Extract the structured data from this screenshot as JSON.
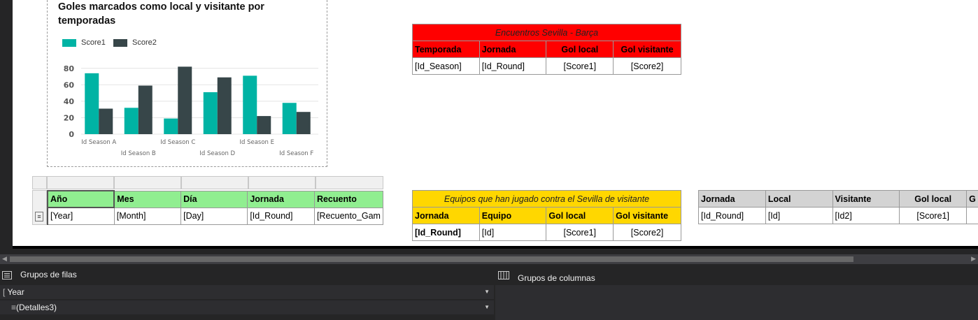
{
  "chart": {
    "title": "Goles marcados como local y visitante por temporadas",
    "legend": [
      "Score1",
      "Score2"
    ]
  },
  "chart_data": {
    "type": "bar",
    "title": "Goles marcados como local y visitante por temporadas",
    "categories": [
      "Id Season A",
      "Id Season B",
      "Id Season C",
      "Id Season D",
      "Id Season E",
      "Id Season F"
    ],
    "series": [
      {
        "name": "Score1",
        "values": [
          74,
          32,
          19,
          51,
          71,
          38
        ],
        "color": "#00b3a4"
      },
      {
        "name": "Score2",
        "values": [
          31,
          59,
          82,
          69,
          22,
          27
        ],
        "color": "#374649"
      }
    ],
    "yticks": [
      "0",
      "20",
      "40",
      "60",
      "80"
    ],
    "ylim": [
      0,
      90
    ],
    "grid": true,
    "legend_position": "top-left"
  },
  "sevilla_barca": {
    "title": "Encuentros Sevilla - Barça",
    "headers": [
      "Temporada",
      "Jornada",
      "Gol local",
      "Gol visitante"
    ],
    "row": [
      "[Id_Season]",
      "[Id_Round]",
      "[Score1]",
      "[Score2]"
    ],
    "color": "#ff0000"
  },
  "date_table": {
    "headers": [
      "Año",
      "Mes",
      "Día",
      "Jornada",
      "Recuento"
    ],
    "row": [
      "[Year]",
      "[Month]",
      "[Day]",
      "[Id_Round]",
      "[Recuento_Gam"
    ],
    "color": "#90ee90"
  },
  "visitante_table": {
    "title": "Equipos que han jugado contra el Sevilla de visitante",
    "headers": [
      "Jornada",
      "Equipo",
      "Gol local",
      "Gol visitante"
    ],
    "row": [
      "[Id_Round]",
      "[Id]",
      "[Score1]",
      "[Score2]"
    ],
    "color": "#ffd700"
  },
  "grey_table": {
    "headers": [
      "Jornada",
      "Local",
      "Visitante",
      "Gol local",
      "G"
    ],
    "row": [
      "[Id_Round]",
      "[Id]",
      "[Id2]",
      "[Score1]",
      ""
    ],
    "color": "#d3d3d3"
  },
  "groups": {
    "row_title": "Grupos de filas",
    "col_title": "Grupos de columnas",
    "row_items": [
      "Year",
      "(Detalles3)"
    ]
  }
}
